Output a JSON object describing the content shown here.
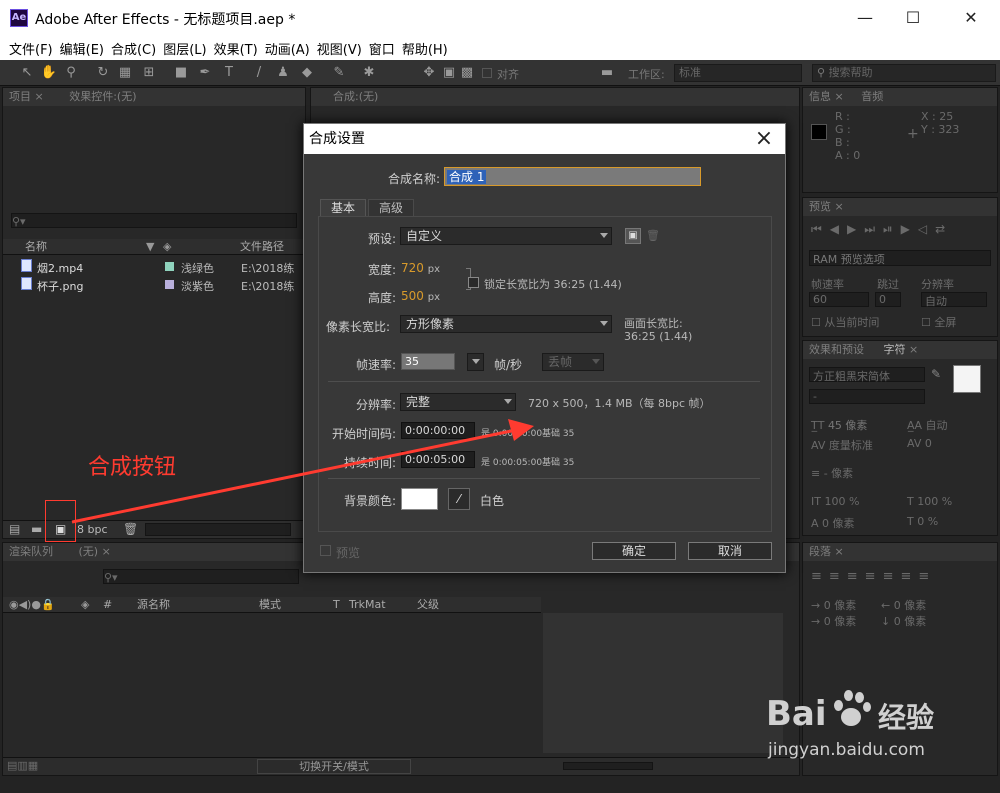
{
  "window": {
    "title": "Adobe After Effects - 无标题项目.aep *",
    "logo": "Ae",
    "controls": [
      "—",
      "☐",
      "✕"
    ]
  },
  "menu": [
    "文件(F)",
    "编辑(E)",
    "合成(C)",
    "图层(L)",
    "效果(T)",
    "动画(A)",
    "视图(V)",
    "窗口",
    "帮助(H)"
  ],
  "toolbar": {
    "snap_label": "对齐",
    "workspace_label": "工作区:",
    "workspace_value": "标准",
    "search_placeholder": "搜索帮助"
  },
  "project_panel": {
    "tabs": [
      "项目",
      "效果控件:(无)"
    ],
    "columns": [
      "名称",
      "文件路径"
    ],
    "items": [
      {
        "name": "烟2.mp4",
        "label": "浅绿色",
        "label_color": "#8fd3bd",
        "path": "E:\\2018练"
      },
      {
        "name": "杯子.png",
        "label": "淡紫色",
        "label_color": "#b9b0dc",
        "path": "E:\\2018练"
      }
    ],
    "bpc": "8 bpc"
  },
  "composition_panel": {
    "tab": "合成:(无)"
  },
  "info_panel": {
    "tabs": [
      "信息",
      "音频"
    ],
    "rgba": [
      "R :",
      "G :",
      "B :",
      "A : 0"
    ],
    "x": "X : 25",
    "y": "Y : 323"
  },
  "preview_panel": {
    "tab": "预览",
    "ram": "RAM 预览选项",
    "labels": [
      "帧速率",
      "跳过",
      "分辨率"
    ],
    "values": [
      "60",
      "0",
      "自动"
    ],
    "from_current": "从当前时间",
    "fullscreen": "全屏"
  },
  "character_panel": {
    "tabs": [
      "效果和预设",
      "字符"
    ],
    "font": "方正粗黑宋简体",
    "size": "45 像素",
    "leading": "自动",
    "kerning": "度量标准",
    "tracking": "0",
    "stroke": "- 像素",
    "scale_v": "100 %",
    "scale_h": "100 %",
    "baseline": "0 像素",
    "tsume": "0 %"
  },
  "paragraph_panel": {
    "tab": "段落",
    "indent1": "0 像素",
    "indent2": "0 像素",
    "indent3": "0 像素",
    "indent4": "0 像素"
  },
  "timeline_panel": {
    "tabs": [
      "渲染队列",
      "(无)"
    ],
    "columns": [
      "源名称",
      "模式",
      "T",
      "TrkMat",
      "父级"
    ],
    "toggle_label": "切换开关/模式"
  },
  "dialog": {
    "title": "合成设置",
    "name_label": "合成名称:",
    "name_value": "合成 1",
    "tabs": [
      "基本",
      "高级"
    ],
    "preset_label": "预设:",
    "preset_value": "自定义",
    "width_label": "宽度:",
    "width_value": "720",
    "width_unit": "px",
    "height_label": "高度:",
    "height_value": "500",
    "height_unit": "px",
    "lock_aspect": "锁定长宽比为 36:25 (1.44)",
    "pixel_aspect_label": "像素长宽比:",
    "pixel_aspect_value": "方形像素",
    "frame_aspect_label": "画面长宽比:",
    "frame_aspect_value": "36:25 (1.44)",
    "fps_label": "帧速率:",
    "fps_value": "35",
    "fps_unit": "帧/秒",
    "fps_drop": "丢帧",
    "resolution_label": "分辨率:",
    "resolution_value": "完整",
    "resolution_info": "720 x 500，1.4 MB（每 8bpc 帧）",
    "start_tc_label": "开始时间码:",
    "start_tc_value": "0:00:00:00",
    "start_tc_info": "是 0:00:00:00",
    "start_tc_base": "基础 35",
    "duration_label": "持续时间:",
    "duration_value": "0:00:05:00",
    "duration_info": "是 0:00:05:00",
    "duration_base": "基础 35",
    "bg_label": "背景颜色:",
    "bg_color_name": "白色",
    "bg_color": "#ffffff",
    "preview_label": "预览",
    "ok_label": "确定",
    "cancel_label": "取消"
  },
  "annotation": {
    "text": "合成按钮",
    "color": "#ff3b30"
  },
  "watermark": {
    "brand": "Bai",
    "brand_suffix": "经验",
    "url": "jingyan.baidu.com"
  }
}
